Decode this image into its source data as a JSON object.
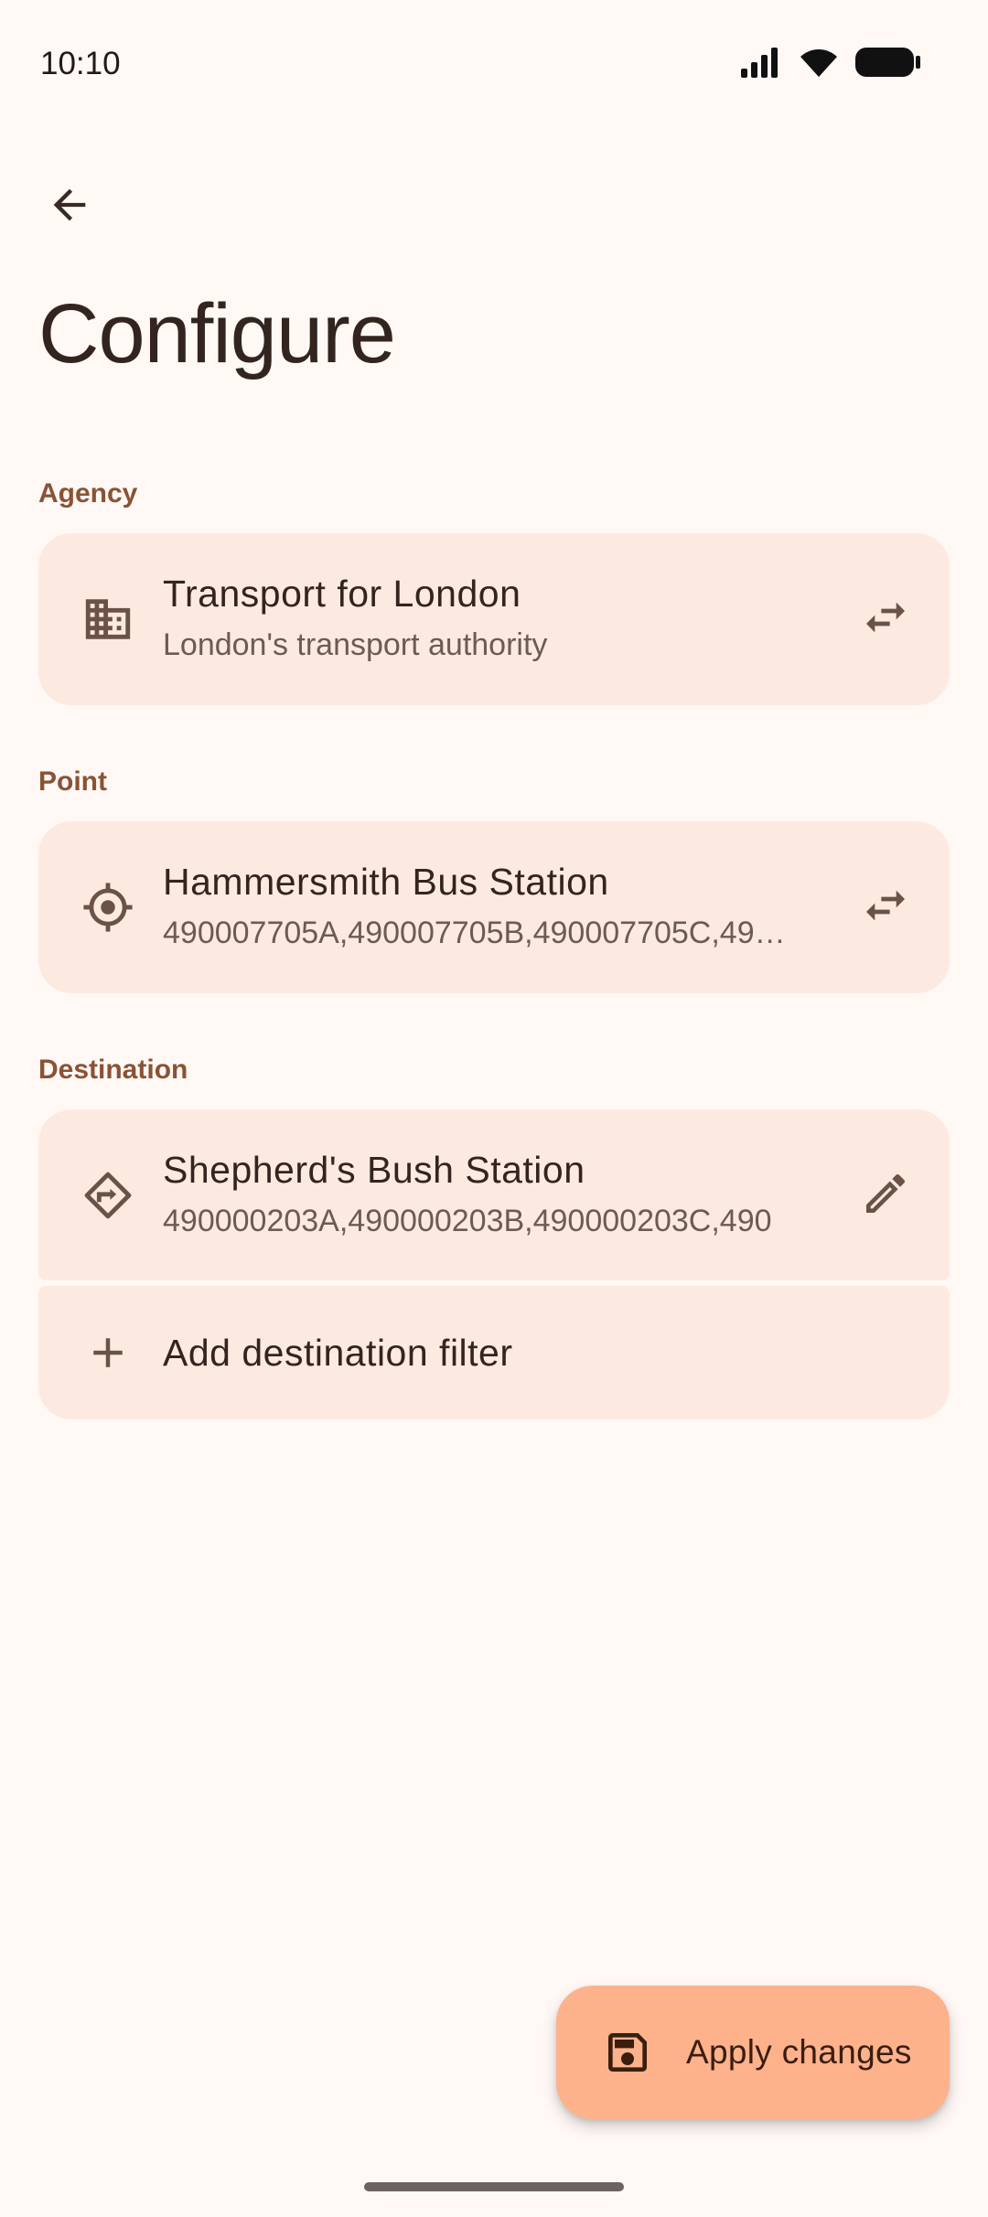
{
  "status_bar": {
    "time": "10:10",
    "icons": [
      "signal-icon",
      "wifi-icon",
      "battery-icon"
    ]
  },
  "header": {
    "back_icon": "arrow-back-icon",
    "title": "Configure"
  },
  "sections": {
    "agency": {
      "label": "Agency",
      "title": "Transport for London",
      "subtitle": "London's transport authority",
      "icon": "building-icon",
      "action_icon": "swap-icon"
    },
    "point": {
      "label": "Point",
      "title": "Hammersmith Bus Station",
      "subtitle": "490007705A,490007705B,490007705C,49…",
      "icon": "target-icon",
      "action_icon": "swap-icon"
    },
    "destination": {
      "label": "Destination",
      "title": "Shepherd's Bush Station",
      "subtitle": "490000203A,490000203B,490000203C,490",
      "icon": "directions-icon",
      "action_icon": "edit-icon",
      "add_filter_label": "Add destination filter",
      "add_icon": "plus-icon"
    }
  },
  "fab": {
    "label": "Apply changes",
    "icon": "save-icon"
  },
  "colors": {
    "background": "#FFF8F5",
    "card": "#FCEAE0",
    "section_label": "#8A5235",
    "fab": "#FDB28C",
    "text_primary": "#33241F",
    "text_secondary": "#6E5A52"
  }
}
